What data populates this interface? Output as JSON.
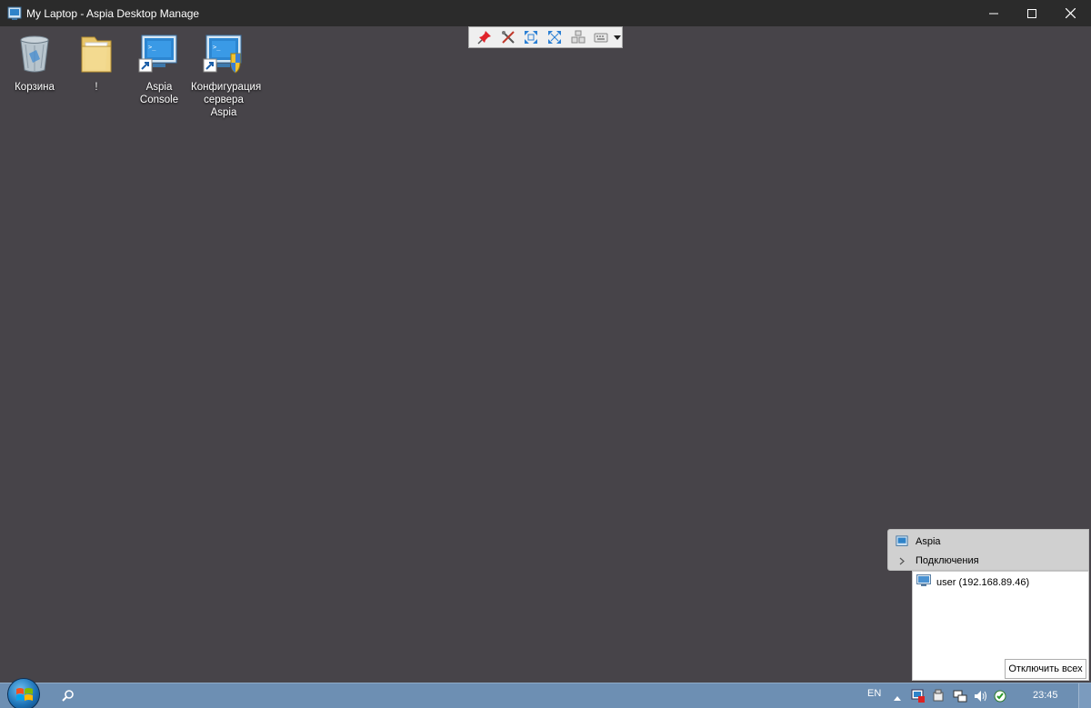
{
  "window": {
    "title": "My Laptop - Aspia Desktop Manage"
  },
  "desktop_icons": [
    {
      "label": "Корзина",
      "icon": "recycle-bin-icon"
    },
    {
      "label": "!",
      "icon": "folder-icon"
    },
    {
      "label": "Aspia Console",
      "icon": "aspia-console-icon"
    },
    {
      "label": "Конфигурация сервера Aspia",
      "icon": "aspia-server-config-icon"
    }
  ],
  "toolbar": {
    "buttons": [
      "pin-icon",
      "settings-tools-icon",
      "fit-window-icon",
      "fullscreen-icon",
      "ctrl-alt-del-icon",
      "keyboard-icon"
    ]
  },
  "taskbar": {
    "language": "EN",
    "clock": "23:45"
  },
  "aspia_panel": {
    "app_name": "Aspia",
    "section_label": "Подключения",
    "connections": [
      {
        "label": "user (192.168.89.46)"
      }
    ],
    "disconnect_all_label": "Отключить всех"
  },
  "colors": {
    "desktop": "#474449",
    "titlebar": "#2b2b2b",
    "taskbar": "#6d8fb3"
  }
}
